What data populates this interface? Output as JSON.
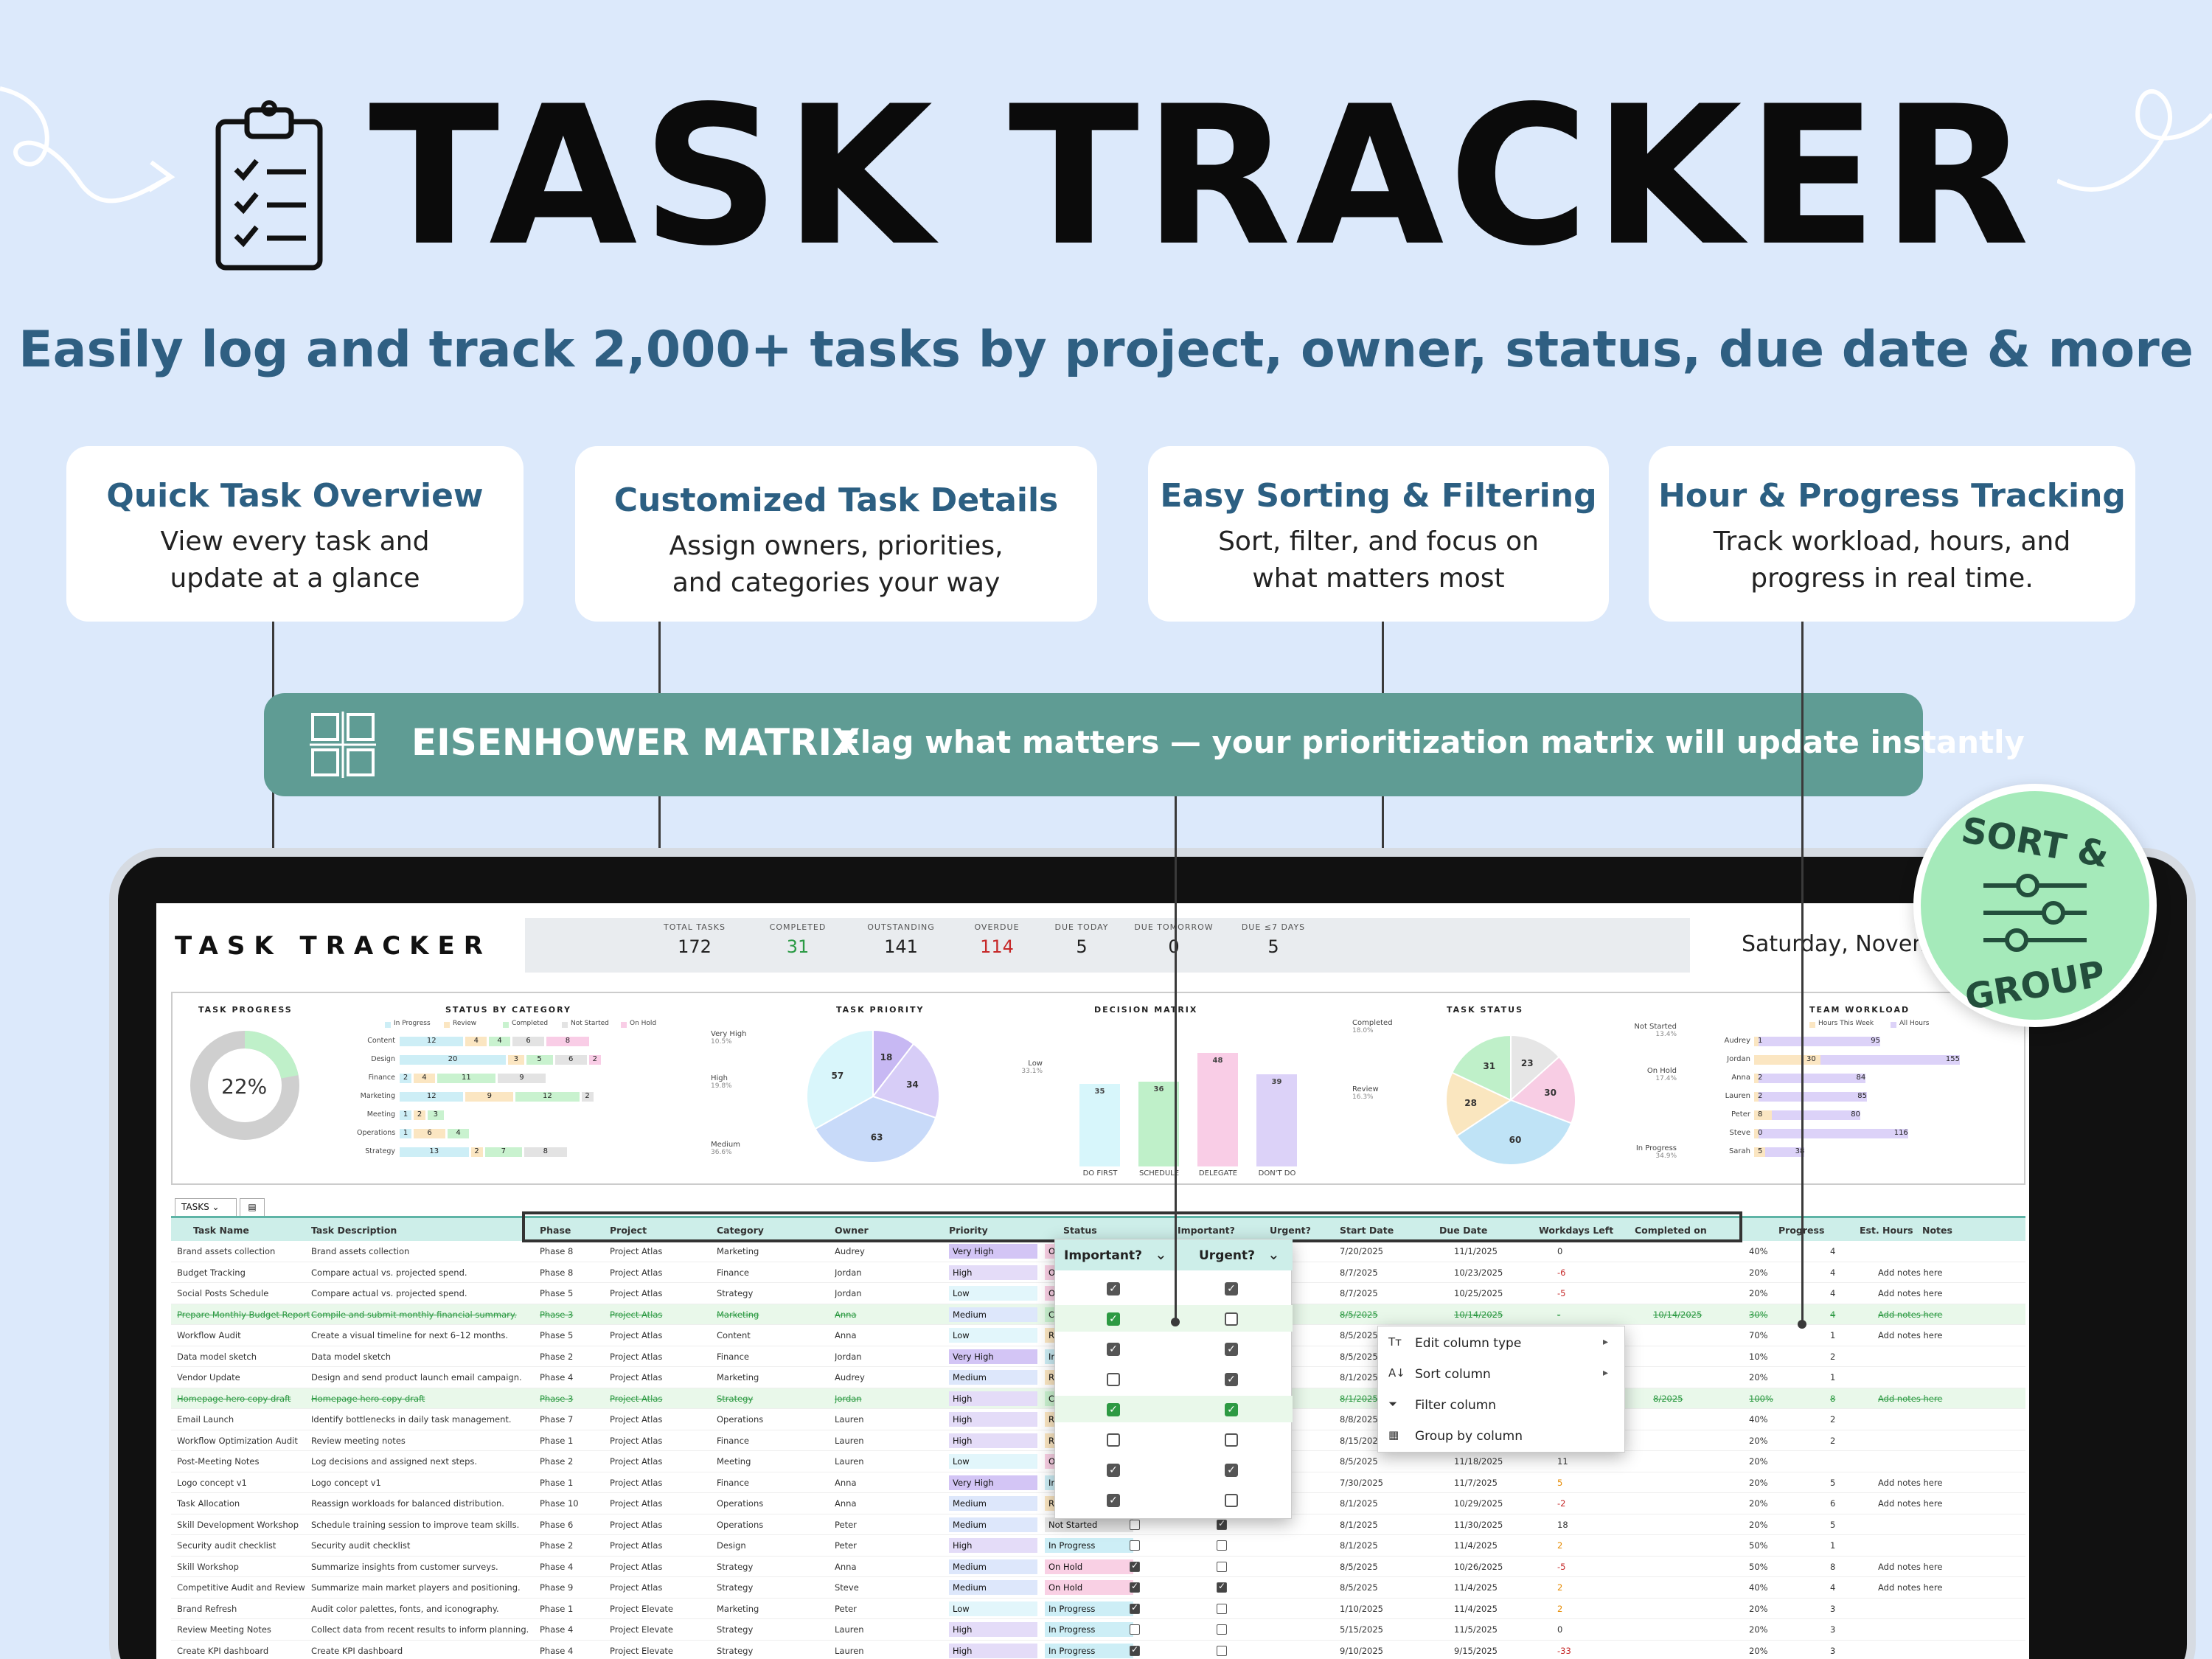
{
  "hero": {
    "title": "TASK TRACKER",
    "subtitle": "Easily log and track 2,000+ tasks by project, owner, status, due date & more"
  },
  "features": [
    {
      "title": "Quick Task Overview",
      "desc": "View every task and update at a glance"
    },
    {
      "title": "Customized Task Details",
      "desc": "Assign owners, priorities, and categories your way"
    },
    {
      "title": "Easy Sorting & Filtering",
      "desc": "Sort, filter, and focus on what matters most"
    },
    {
      "title": "Hour & Progress Tracking",
      "desc": "Track workload, hours, and progress in real time."
    }
  ],
  "banner": {
    "title": "EISENHOWER MATRIX",
    "subtitle": "Flag what matters — your prioritization matrix will update instantly"
  },
  "badge": {
    "top": "SORT &",
    "bottom": "GROUP"
  },
  "sheet": {
    "title": "TASK TRACKER",
    "date": "Saturday, Novemb",
    "kpis": [
      {
        "label": "TOTAL TASKS",
        "value": "172"
      },
      {
        "label": "COMPLETED",
        "value": "31"
      },
      {
        "label": "OUTSTANDING",
        "value": "141"
      },
      {
        "label": "OVERDUE",
        "value": "114"
      },
      {
        "label": "DUE TODAY",
        "value": "5"
      },
      {
        "label": "DUE TOMORROW",
        "value": "0"
      },
      {
        "label": "DUE ≤7 DAYS",
        "value": "5"
      }
    ],
    "colors": {
      "accent": "#5f9c94",
      "completed": "#2a9a44",
      "overdue": "#c62828",
      "header": "#cdeee9"
    }
  },
  "dashboard": {
    "progress": {
      "title": "TASK PROGRESS",
      "value": 0.22,
      "label": "22%"
    },
    "status_by_category": {
      "title": "STATUS BY CATEGORY",
      "legend": [
        "In Progress",
        "Review",
        "Completed",
        "Not Started",
        "On Hold"
      ],
      "rows": [
        {
          "name": "Content",
          "values": [
            12,
            4,
            4,
            6,
            8
          ]
        },
        {
          "name": "Design",
          "values": [
            20,
            3,
            5,
            6,
            2
          ]
        },
        {
          "name": "Finance",
          "values": [
            2,
            4,
            11,
            9,
            0
          ]
        },
        {
          "name": "Marketing",
          "values": [
            12,
            9,
            12,
            2,
            0
          ]
        },
        {
          "name": "Meeting",
          "values": [
            1,
            2,
            3,
            0,
            0
          ]
        },
        {
          "name": "Operations",
          "values": [
            1,
            6,
            4,
            0,
            0
          ]
        },
        {
          "name": "Strategy",
          "values": [
            13,
            2,
            7,
            8,
            0
          ]
        }
      ]
    },
    "task_priority": {
      "title": "TASK PRIORITY",
      "slices": [
        {
          "name": "Very High",
          "value": 18,
          "pct": "10.5%"
        },
        {
          "name": "High",
          "value": 34,
          "pct": "19.8%"
        },
        {
          "name": "Medium",
          "value": 63,
          "pct": "36.6%"
        },
        {
          "name": "Low",
          "value": 57,
          "pct": "33.1%"
        }
      ]
    },
    "decision_matrix": {
      "title": "DECISION MATRIX",
      "bars": [
        {
          "name": "DO FIRST",
          "value": 35
        },
        {
          "name": "SCHEDULE",
          "value": 36
        },
        {
          "name": "DELEGATE",
          "value": 48
        },
        {
          "name": "DON'T DO",
          "value": 39
        }
      ]
    },
    "task_status": {
      "title": "TASK STATUS",
      "slices": [
        {
          "name": "Not Started",
          "value": 23,
          "pct": "13.4%"
        },
        {
          "name": "On Hold",
          "value": 30,
          "pct": "17.4%"
        },
        {
          "name": "In Progress",
          "value": 60,
          "pct": "34.9%"
        },
        {
          "name": "Review",
          "value": 28,
          "pct": "16.3%"
        },
        {
          "name": "Completed",
          "value": 31,
          "pct": "18.0%"
        }
      ]
    },
    "team_workload": {
      "title": "TEAM WORKLOAD",
      "legend": [
        "Hours This Week",
        "All Hours"
      ],
      "rows": [
        {
          "name": "Audrey",
          "week": 1,
          "all": 95
        },
        {
          "name": "Jordan",
          "week": 30,
          "all": 155
        },
        {
          "name": "Anna",
          "week": 2,
          "all": 84
        },
        {
          "name": "Lauren",
          "week": 2,
          "all": 85
        },
        {
          "name": "Peter",
          "week": 8,
          "all": 80
        },
        {
          "name": "Steve",
          "week": 0,
          "all": 116
        },
        {
          "name": "Sarah",
          "week": 5,
          "all": 38
        }
      ]
    }
  },
  "table": {
    "tabs": [
      "TASKS"
    ],
    "columns": [
      "Task Name",
      "Task Description",
      "Phase",
      "Project",
      "Category",
      "Owner",
      "Priority",
      "Status",
      "Important?",
      "Urgent?",
      "Start Date",
      "Due Date",
      "Workdays Left",
      "Completed on",
      "Progress",
      "Est. Hours",
      "Notes"
    ],
    "rows": [
      {
        "name": "Brand assets collection",
        "desc": "Brand assets collection",
        "phase": "Phase 8",
        "project": "Project Atlas",
        "category": "Marketing",
        "owner": "Audrey",
        "priority": "Very High",
        "status": "On Hold",
        "imp": true,
        "urg": true,
        "start": "7/20/2025",
        "due": "11/1/2025",
        "left": "0",
        "completed": "",
        "progress": "40%",
        "hours": "4",
        "notes": "",
        "done": false
      },
      {
        "name": "Budget Tracking",
        "desc": "Compare actual vs. projected spend.",
        "phase": "Phase 8",
        "project": "Project Atlas",
        "category": "Finance",
        "owner": "Jordan",
        "priority": "High",
        "status": "On Hold",
        "imp": false,
        "urg": false,
        "start": "8/7/2025",
        "due": "10/23/2025",
        "left": "-6",
        "completed": "",
        "progress": "20%",
        "hours": "4",
        "notes": "Add notes here",
        "done": false
      },
      {
        "name": "Social Posts Schedule",
        "desc": "Compare actual vs. projected spend.",
        "phase": "Phase 5",
        "project": "Project Atlas",
        "category": "Strategy",
        "owner": "Jordan",
        "priority": "Low",
        "status": "On Hold",
        "imp": false,
        "urg": false,
        "start": "8/7/2025",
        "due": "10/25/2025",
        "left": "-5",
        "completed": "",
        "progress": "20%",
        "hours": "4",
        "notes": "Add notes here",
        "done": false
      },
      {
        "name": "Prepare Monthly Budget Report",
        "desc": "Compile and submit monthly financial summary.",
        "phase": "Phase 3",
        "project": "Project Atlas",
        "category": "Marketing",
        "owner": "Anna",
        "priority": "Medium",
        "status": "Completed",
        "imp": false,
        "urg": false,
        "start": "8/5/2025",
        "due": "10/14/2025",
        "left": "-",
        "completed": "10/14/2025",
        "progress": "30%",
        "hours": "4",
        "notes": "Add notes here",
        "done": true
      },
      {
        "name": "Workflow Audit",
        "desc": "Create a visual timeline for next 6–12 months.",
        "phase": "Phase 5",
        "project": "Project Atlas",
        "category": "Content",
        "owner": "Anna",
        "priority": "Low",
        "status": "Review",
        "imp": false,
        "urg": false,
        "start": "8/5/2025",
        "due": "",
        "left": "",
        "completed": "",
        "progress": "70%",
        "hours": "1",
        "notes": "Add notes here",
        "done": false
      },
      {
        "name": "Data model sketch",
        "desc": "Data model sketch",
        "phase": "Phase 2",
        "project": "Project Atlas",
        "category": "Finance",
        "owner": "Jordan",
        "priority": "Very High",
        "status": "In Progress",
        "imp": false,
        "urg": false,
        "start": "8/5/2025",
        "due": "",
        "left": "",
        "completed": "",
        "progress": "10%",
        "hours": "2",
        "notes": "",
        "done": false
      },
      {
        "name": "Vendor Update",
        "desc": "Design and send product launch email campaign.",
        "phase": "Phase 4",
        "project": "Project Atlas",
        "category": "Marketing",
        "owner": "Audrey",
        "priority": "Medium",
        "status": "Review",
        "imp": false,
        "urg": false,
        "start": "8/1/2025",
        "due": "",
        "left": "",
        "completed": "",
        "progress": "20%",
        "hours": "1",
        "notes": "",
        "done": false
      },
      {
        "name": "Homepage hero copy draft",
        "desc": "Homepage hero copy draft",
        "phase": "Phase 3",
        "project": "Project Atlas",
        "category": "Strategy",
        "owner": "Jordan",
        "priority": "High",
        "status": "Completed",
        "imp": false,
        "urg": false,
        "start": "8/1/2025",
        "due": "",
        "left": "",
        "completed": "8/2025",
        "progress": "100%",
        "hours": "8",
        "notes": "Add notes here",
        "done": true
      },
      {
        "name": "Email Launch",
        "desc": "Identify bottlenecks in daily task management.",
        "phase": "Phase 7",
        "project": "Project Atlas",
        "category": "Operations",
        "owner": "Lauren",
        "priority": "High",
        "status": "Review",
        "imp": false,
        "urg": false,
        "start": "8/8/2025",
        "due": "",
        "left": "",
        "completed": "",
        "progress": "40%",
        "hours": "2",
        "notes": "",
        "done": false
      },
      {
        "name": "Workflow Optimization Audit",
        "desc": "Review meeting notes",
        "phase": "Phase 1",
        "project": "Project Atlas",
        "category": "Finance",
        "owner": "Lauren",
        "priority": "High",
        "status": "Review",
        "imp": false,
        "urg": false,
        "start": "8/15/2025",
        "due": "",
        "left": "",
        "completed": "",
        "progress": "20%",
        "hours": "2",
        "notes": "",
        "done": false
      },
      {
        "name": "Post-Meeting Notes",
        "desc": "Log decisions and assigned next steps.",
        "phase": "Phase 2",
        "project": "Project Atlas",
        "category": "Meeting",
        "owner": "Lauren",
        "priority": "Low",
        "status": "On Hold",
        "imp": false,
        "urg": false,
        "start": "8/5/2025",
        "due": "11/18/2025",
        "left": "11",
        "completed": "",
        "progress": "20%",
        "hours": "",
        "notes": "",
        "done": false
      },
      {
        "name": "Logo concept v1",
        "desc": "Logo concept v1",
        "phase": "Phase 1",
        "project": "Project Atlas",
        "category": "Finance",
        "owner": "Anna",
        "priority": "Very High",
        "status": "In Progress",
        "imp": false,
        "urg": false,
        "start": "7/30/2025",
        "due": "11/7/2025",
        "left": "5",
        "completed": "",
        "progress": "20%",
        "hours": "5",
        "notes": "Add notes here",
        "done": false
      },
      {
        "name": "Task Allocation",
        "desc": "Reassign workloads for balanced distribution.",
        "phase": "Phase 10",
        "project": "Project Atlas",
        "category": "Operations",
        "owner": "Anna",
        "priority": "Medium",
        "status": "Review",
        "imp": false,
        "urg": false,
        "start": "8/1/2025",
        "due": "10/29/2025",
        "left": "-2",
        "completed": "",
        "progress": "20%",
        "hours": "6",
        "notes": "Add notes here",
        "done": false
      },
      {
        "name": "Skill Development Workshop",
        "desc": "Schedule training session to improve team skills.",
        "phase": "Phase 6",
        "project": "Project Atlas",
        "category": "Operations",
        "owner": "Peter",
        "priority": "Medium",
        "status": "Not Started",
        "imp": false,
        "urg": true,
        "start": "8/1/2025",
        "due": "11/30/2025",
        "left": "18",
        "completed": "",
        "progress": "20%",
        "hours": "5",
        "notes": "",
        "done": false
      },
      {
        "name": "Security audit checklist",
        "desc": "Security audit checklist",
        "phase": "Phase 2",
        "project": "Project Atlas",
        "category": "Design",
        "owner": "Peter",
        "priority": "High",
        "status": "In Progress",
        "imp": false,
        "urg": false,
        "start": "8/1/2025",
        "due": "11/4/2025",
        "left": "2",
        "completed": "",
        "progress": "50%",
        "hours": "1",
        "notes": "",
        "done": false
      },
      {
        "name": "Skill Workshop",
        "desc": "Summarize insights from customer surveys.",
        "phase": "Phase 4",
        "project": "Project Atlas",
        "category": "Strategy",
        "owner": "Anna",
        "priority": "Medium",
        "status": "On Hold",
        "imp": true,
        "urg": false,
        "start": "8/5/2025",
        "due": "10/26/2025",
        "left": "-5",
        "completed": "",
        "progress": "50%",
        "hours": "8",
        "notes": "Add notes here",
        "done": false
      },
      {
        "name": "Competitive Audit and Review",
        "desc": "Summarize main market players and positioning.",
        "phase": "Phase 9",
        "project": "Project Atlas",
        "category": "Strategy",
        "owner": "Steve",
        "priority": "Medium",
        "status": "On Hold",
        "imp": true,
        "urg": true,
        "start": "8/5/2025",
        "due": "11/4/2025",
        "left": "2",
        "completed": "",
        "progress": "40%",
        "hours": "4",
        "notes": "Add notes here",
        "done": false
      },
      {
        "name": "Brand Refresh",
        "desc": "Audit color palettes, fonts, and iconography.",
        "phase": "Phase 1",
        "project": "Project Elevate",
        "category": "Marketing",
        "owner": "Peter",
        "priority": "Low",
        "status": "In Progress",
        "imp": true,
        "urg": false,
        "start": "1/10/2025",
        "due": "11/4/2025",
        "left": "2",
        "completed": "",
        "progress": "20%",
        "hours": "3",
        "notes": "",
        "done": false
      },
      {
        "name": "Review Meeting Notes",
        "desc": "Collect data from recent results to inform planning.",
        "phase": "Phase 4",
        "project": "Project Elevate",
        "category": "Strategy",
        "owner": "Lauren",
        "priority": "High",
        "status": "In Progress",
        "imp": false,
        "urg": false,
        "start": "5/15/2025",
        "due": "11/5/2025",
        "left": "0",
        "completed": "",
        "progress": "20%",
        "hours": "3",
        "notes": "",
        "done": false
      },
      {
        "name": "Create KPI dashboard",
        "desc": "Create KPI dashboard",
        "phase": "Phase 4",
        "project": "Project Elevate",
        "category": "Strategy",
        "owner": "Lauren",
        "priority": "High",
        "status": "In Progress",
        "imp": true,
        "urg": false,
        "start": "9/10/2025",
        "due": "9/15/2025",
        "left": "-33",
        "completed": "",
        "progress": "20%",
        "hours": "3",
        "notes": "",
        "done": false
      }
    ]
  },
  "popup_flags": {
    "headers": [
      "Important?",
      "Urgent?"
    ],
    "rows": [
      [
        true,
        true
      ],
      [
        true,
        false
      ],
      [
        true,
        true
      ],
      [
        false,
        true
      ],
      [
        true,
        true
      ],
      [
        false,
        false
      ],
      [
        true,
        true
      ],
      [
        true,
        false
      ]
    ]
  },
  "context_menu": {
    "items": [
      {
        "label": "Edit column type",
        "icon": "type-icon",
        "arrow": true
      },
      {
        "label": "Sort column",
        "icon": "sort-az-icon",
        "arrow": true
      },
      {
        "label": "Filter column",
        "icon": "filter-icon",
        "arrow": false
      },
      {
        "label": "Group by column",
        "icon": "group-table-icon",
        "arrow": false
      }
    ]
  }
}
